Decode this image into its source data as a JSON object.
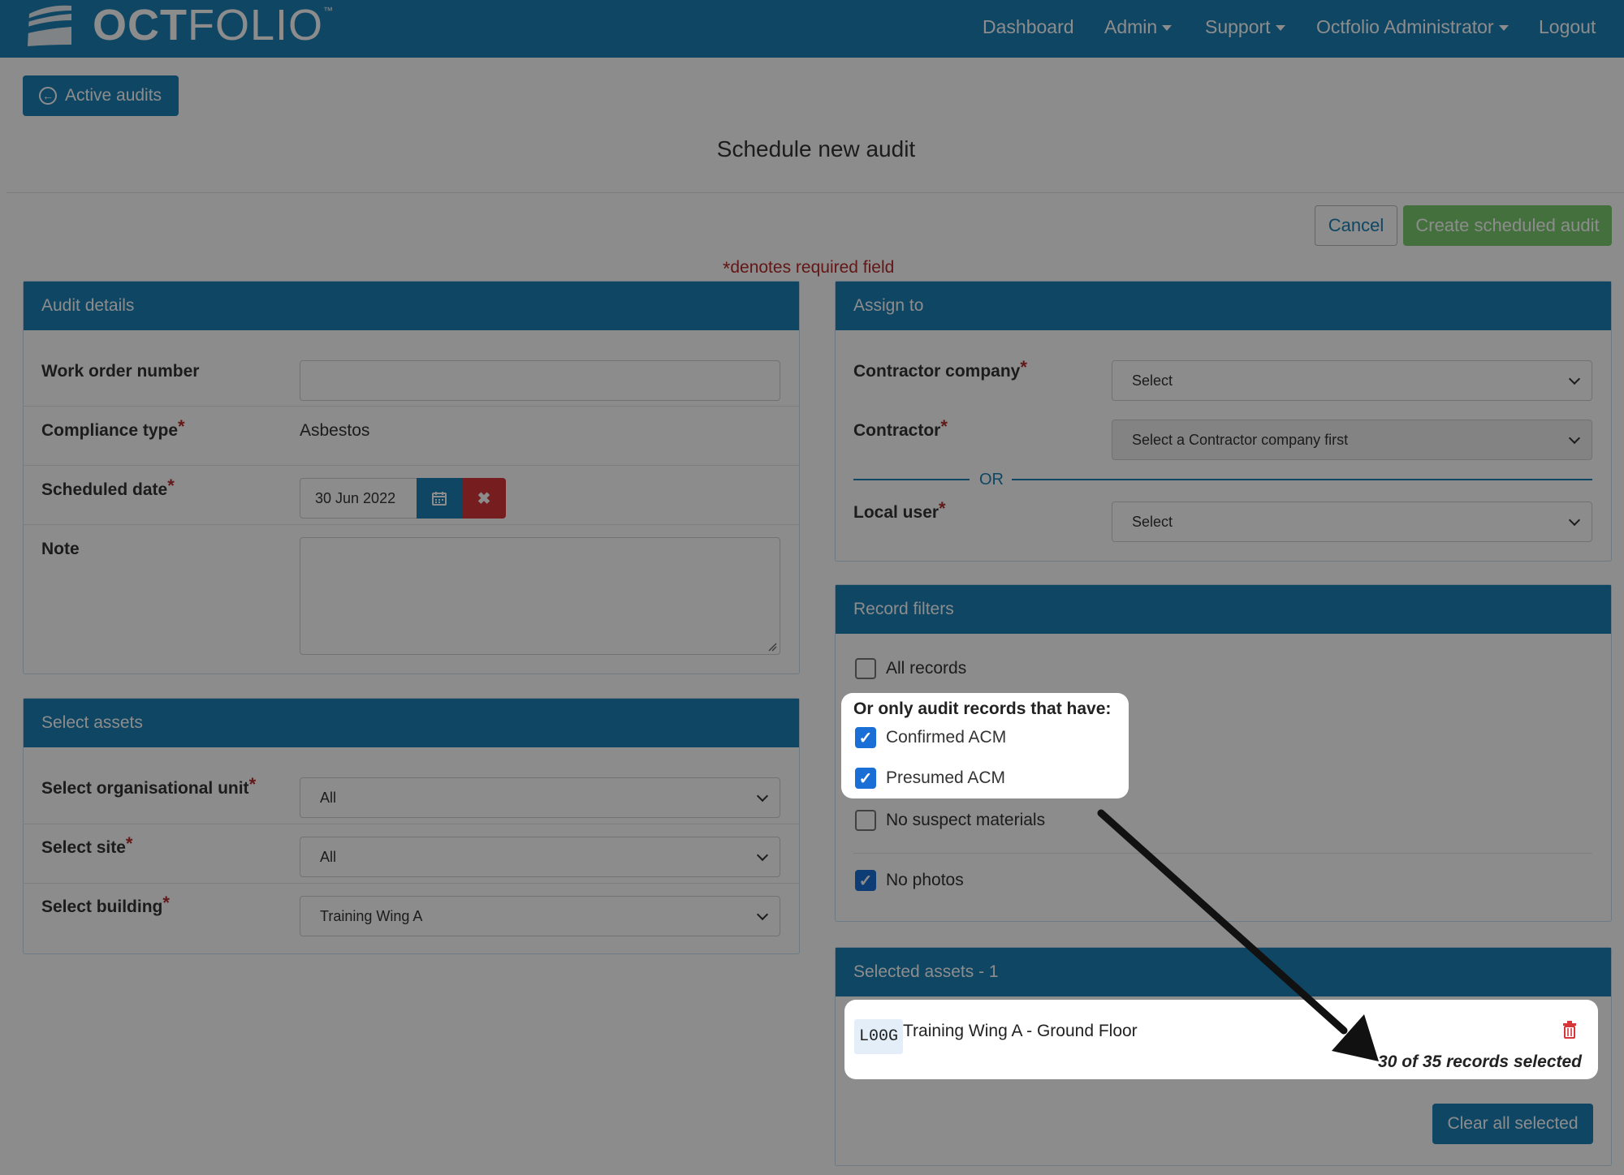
{
  "nav": {
    "logo_bold": "OCT",
    "logo_light": "FOLIO",
    "logo_tm": "™",
    "dashboard": "Dashboard",
    "admin": "Admin",
    "support": "Support",
    "user": "Octfolio Administrator",
    "logout": "Logout"
  },
  "back_button": "Active audits",
  "page_title": "Schedule new audit",
  "actions": {
    "cancel": "Cancel",
    "create": "Create scheduled audit"
  },
  "required_note": {
    "star": "*",
    "text": "denotes required field"
  },
  "audit_details": {
    "title": "Audit details",
    "work_order_label": "Work order number",
    "work_order_value": "",
    "compliance_label": "Compliance type",
    "compliance_value": "Asbestos",
    "scheduled_label": "Scheduled date",
    "scheduled_value": "30 Jun 2022",
    "note_label": "Note",
    "note_value": ""
  },
  "select_assets": {
    "title": "Select assets",
    "org_unit_label": "Select organisational unit",
    "org_unit_value": "All",
    "site_label": "Select site",
    "site_value": "All",
    "building_label": "Select building",
    "building_value": "Training Wing A"
  },
  "assign_to": {
    "title": "Assign to",
    "company_label": "Contractor company",
    "company_value": "Select",
    "contractor_label": "Contractor",
    "contractor_value": "Select a Contractor company first",
    "or_text": "OR",
    "local_user_label": "Local user",
    "local_user_value": "Select"
  },
  "record_filters": {
    "title": "Record filters",
    "all_records": {
      "label": "All records",
      "checked": false
    },
    "group_title": "Or only audit records that have:",
    "confirmed_acm": {
      "label": "Confirmed ACM",
      "checked": true
    },
    "presumed_acm": {
      "label": "Presumed ACM",
      "checked": true
    },
    "no_suspect": {
      "label": "No suspect materials",
      "checked": false
    },
    "no_photos": {
      "label": "No photos",
      "checked": true
    }
  },
  "selected_assets": {
    "title": "Selected assets - 1",
    "items": [
      {
        "code": "L00G",
        "name": "Training Wing A - Ground Floor",
        "count": "30 of 35 records selected"
      }
    ],
    "clear_all": "Clear all selected"
  },
  "colors": {
    "brand": "#1a80b6",
    "danger": "#d6363a",
    "success": "#7ccd70",
    "checkbox": "#1a6fd6"
  },
  "required_star": "*",
  "check_glyph": "✓"
}
